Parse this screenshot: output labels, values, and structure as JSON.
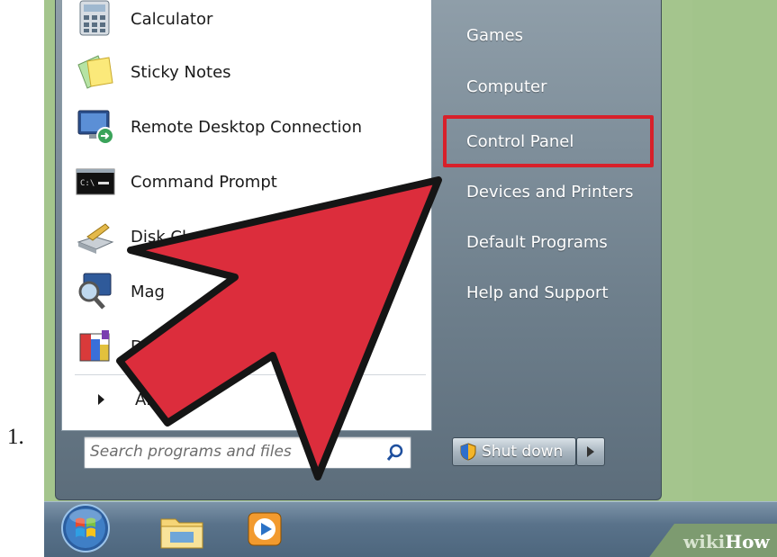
{
  "list_marker": "1.",
  "start_menu": {
    "programs": [
      {
        "label": "Calculator",
        "icon": "calculator-icon"
      },
      {
        "label": "Sticky Notes",
        "icon": "sticky-notes-icon"
      },
      {
        "label": "Remote Desktop Connection",
        "icon": "remote-desktop-icon"
      },
      {
        "label": "Command Prompt",
        "icon": "command-prompt-icon"
      },
      {
        "label": "Disk Cleanup",
        "icon": "disk-cleanup-icon"
      },
      {
        "label": "Mag",
        "icon": "magnifier-icon"
      },
      {
        "label": "Disk Defr",
        "icon": "disk-defragmenter-icon"
      }
    ],
    "all_programs_label": "Al",
    "search": {
      "placeholder": "Search programs and files",
      "icon": "search-icon"
    },
    "right_items": [
      {
        "label": "Games"
      },
      {
        "label": "Computer"
      },
      {
        "label": "Control Panel",
        "highlighted": true
      },
      {
        "label": "Devices and Printers"
      },
      {
        "label": "Default Programs"
      },
      {
        "label": "Help and Support"
      }
    ],
    "shutdown_label": "Shut down",
    "highlight_color": "#d8202a"
  },
  "taskbar": {
    "items": [
      "start-orb",
      "windows-explorer-icon",
      "media-player-icon"
    ]
  },
  "watermark": {
    "wiki": "wiki",
    "how": "How"
  },
  "colors": {
    "arrow_fill": "#dc2d3c",
    "desktop": "#a4c58d",
    "taskbar": "#59728a"
  }
}
